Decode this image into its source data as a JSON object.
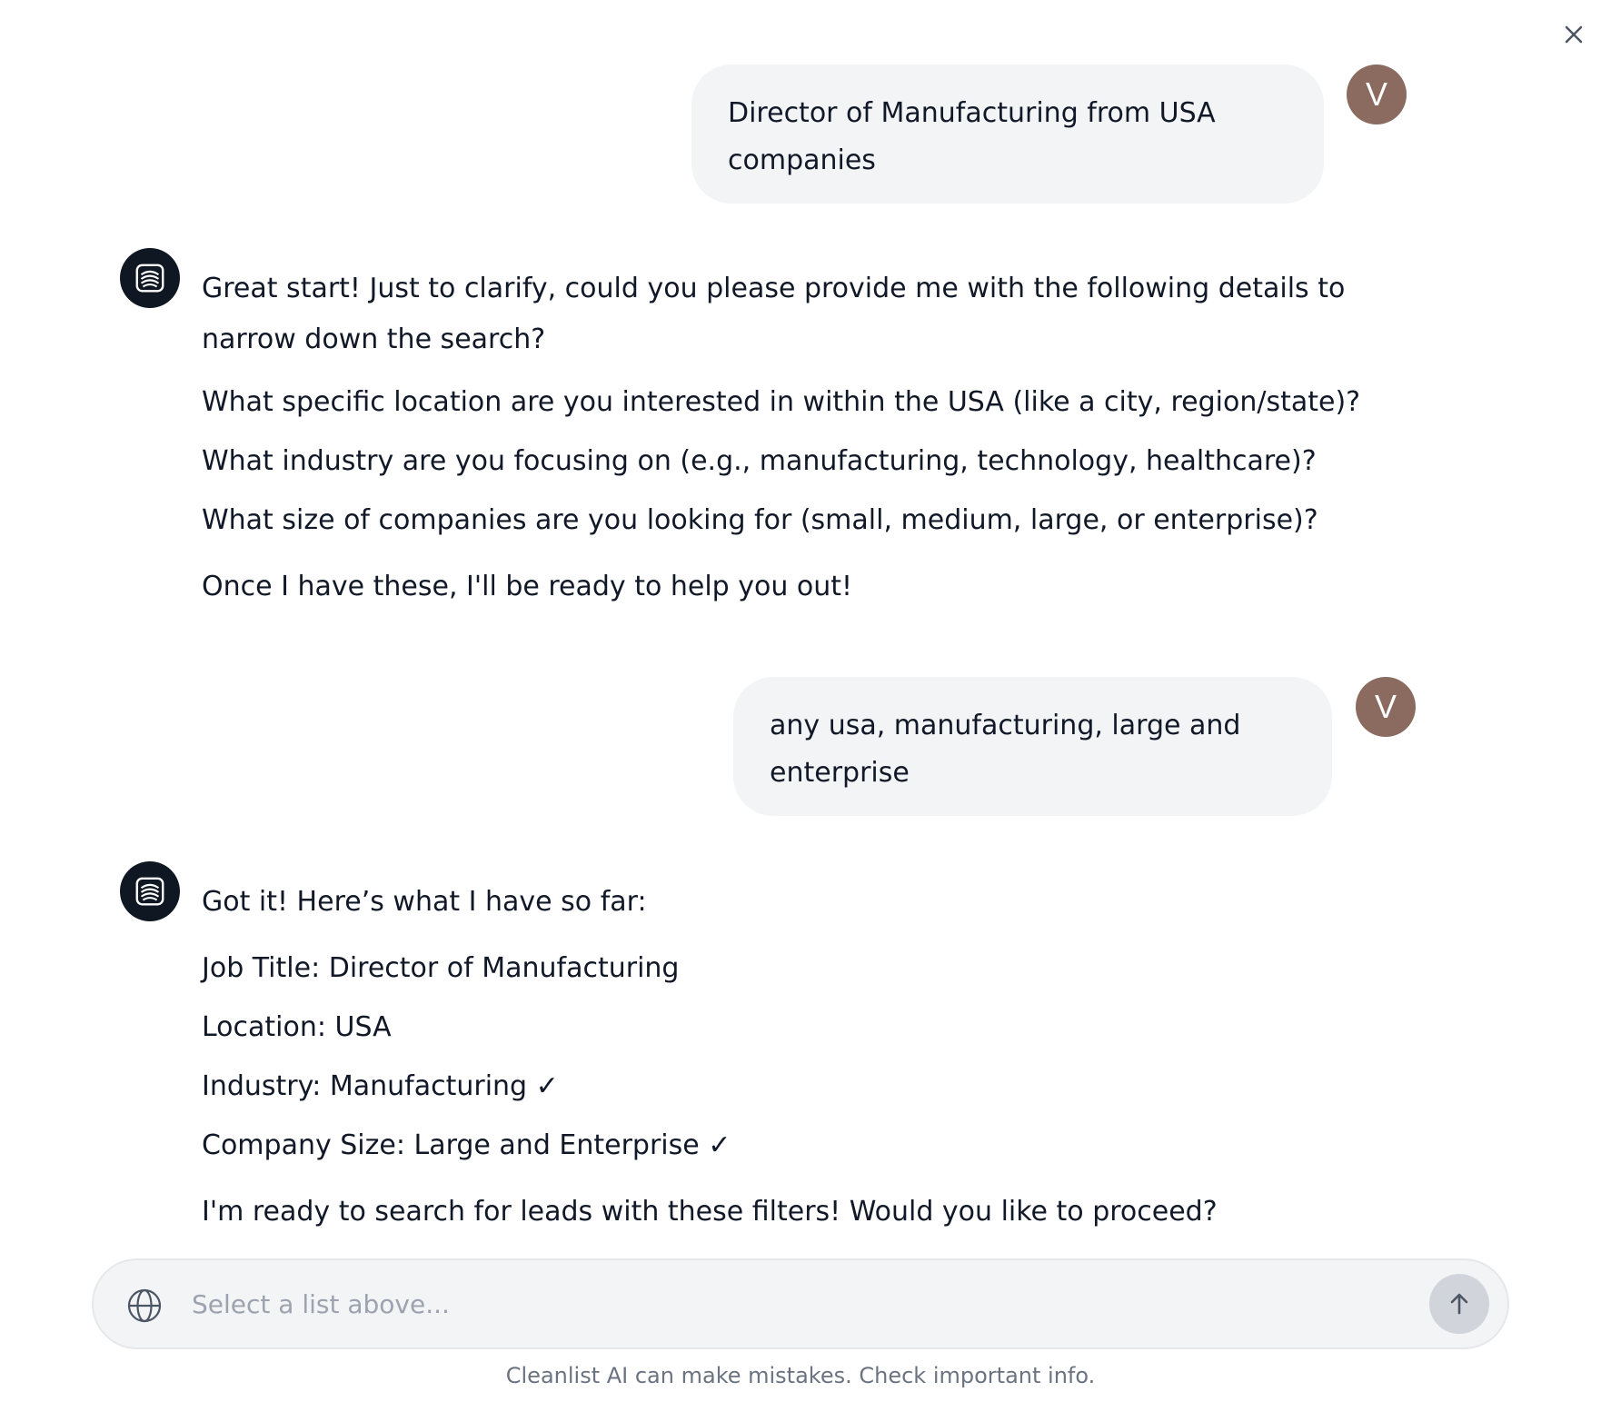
{
  "icons": {
    "close": "close-icon",
    "bot_logo": "cleanlist-logo-icon",
    "globe": "globe-icon",
    "send": "arrow-up-icon"
  },
  "colors": {
    "user_bubble_bg": "#f3f4f6",
    "avatar_bg": "#8b6b5f",
    "bot_logo_bg": "#0f1722",
    "send_button_bg": "#d1d5db",
    "placeholder_text": "#9ca3af"
  },
  "messages": [
    {
      "role": "user",
      "avatar_initial": "V",
      "text": "Director of Manufacturing from USA companies"
    },
    {
      "role": "assistant",
      "paragraphs": [
        "Great start! Just to clarify, could you please provide me with the following details to narrow down the search?",
        "What specific location are you interested in within the USA (like a city, region/state)?",
        "What industry are you focusing on (e.g., manufacturing, technology, healthcare)?",
        "What size of companies are you looking for (small, medium, large, or enterprise)?",
        "Once I have these, I'll be ready to help you out!"
      ]
    },
    {
      "role": "user",
      "avatar_initial": "V",
      "text": "any usa, manufacturing, large and enterprise"
    },
    {
      "role": "assistant",
      "paragraphs": [
        "Got it! Here’s what I have so far:",
        "Job Title: Director of Manufacturing",
        "Location: USA",
        "Industry: Manufacturing ✓",
        "Company Size: Large and Enterprise ✓",
        "I'm ready to search for leads with these filters! Would you like to proceed?"
      ]
    }
  ],
  "composer": {
    "placeholder": "Select a list above...",
    "value": ""
  },
  "disclaimer": "Cleanlist AI can make mistakes. Check important info."
}
